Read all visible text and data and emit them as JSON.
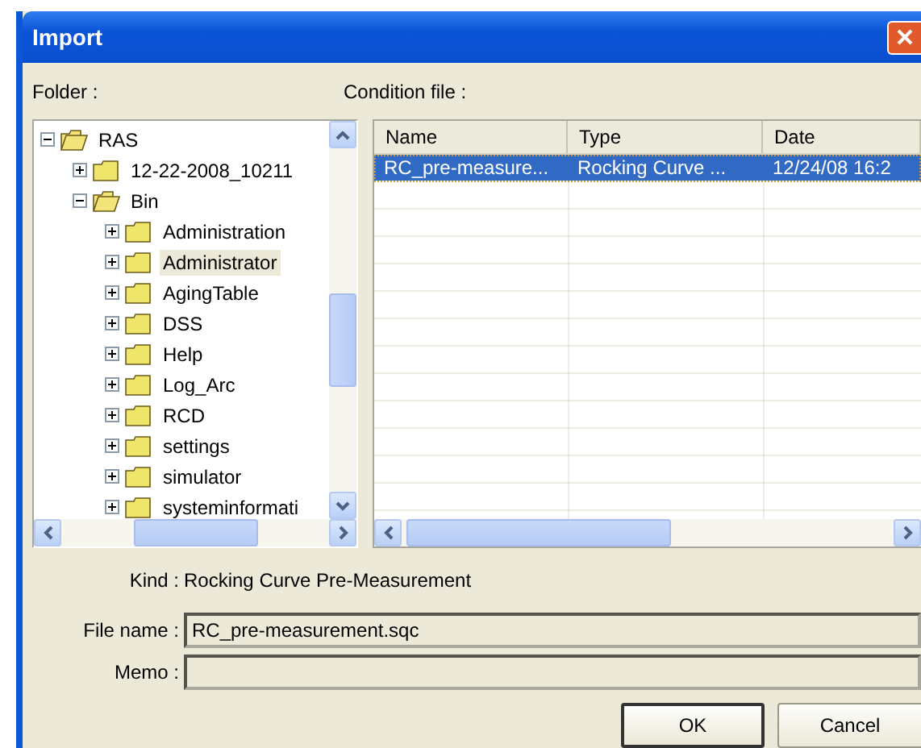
{
  "window": {
    "title": "Import"
  },
  "folder_label": "Folder :",
  "condition_label": "Condition file :",
  "tree": [
    {
      "label": "RAS",
      "expanded": true,
      "selected": false,
      "children": [
        {
          "label": "12-22-2008_10211",
          "expanded": false,
          "selected": false
        },
        {
          "label": "Bin",
          "expanded": true,
          "selected": false,
          "children": [
            {
              "label": "Administration",
              "expanded": false,
              "selected": false
            },
            {
              "label": "Administrator",
              "expanded": false,
              "selected": true
            },
            {
              "label": "AgingTable",
              "expanded": false,
              "selected": false
            },
            {
              "label": "DSS",
              "expanded": false,
              "selected": false
            },
            {
              "label": "Help",
              "expanded": false,
              "selected": false
            },
            {
              "label": "Log_Arc",
              "expanded": false,
              "selected": false
            },
            {
              "label": "RCD",
              "expanded": false,
              "selected": false
            },
            {
              "label": "settings",
              "expanded": false,
              "selected": false
            },
            {
              "label": "simulator",
              "expanded": false,
              "selected": false
            },
            {
              "label": "systeminformati",
              "expanded": false,
              "selected": false
            }
          ]
        }
      ]
    }
  ],
  "table": {
    "columns": [
      "Name",
      "Type",
      "Date"
    ],
    "rows": [
      {
        "cells": [
          "RC_pre-measure...",
          "Rocking Curve ...",
          "12/24/08 16:2"
        ],
        "selected": true
      }
    ]
  },
  "kind": {
    "label": "Kind :",
    "value": "Rocking Curve Pre-Measurement"
  },
  "file_name": {
    "label": "File name :",
    "value": "RC_pre-measurement.sqc"
  },
  "memo": {
    "label": "Memo :"
  },
  "buttons": [
    "OK",
    "Cancel"
  ]
}
